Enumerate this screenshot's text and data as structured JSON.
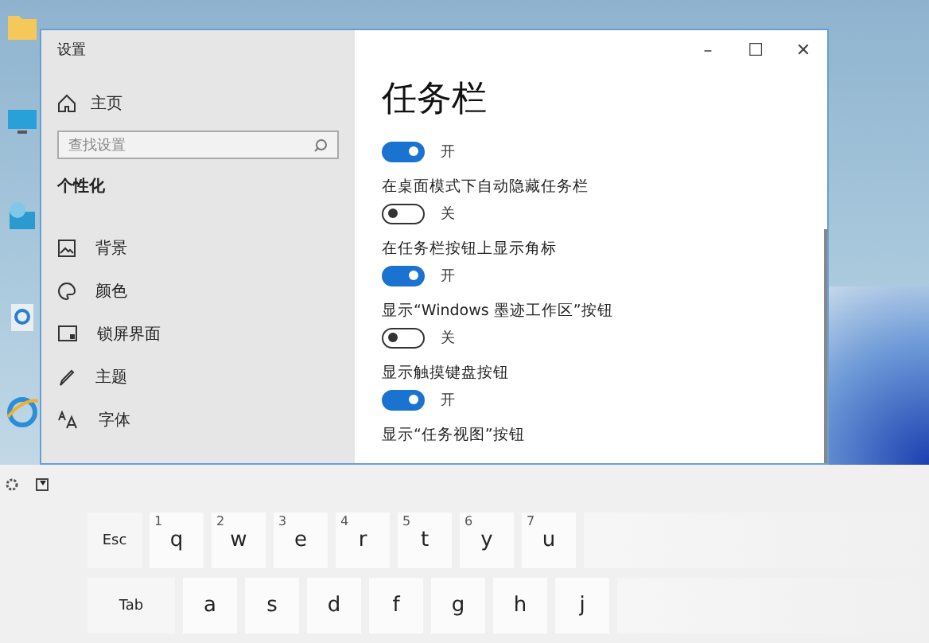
{
  "window": {
    "title": "设置",
    "controls": [
      "–",
      "☐",
      "✕"
    ]
  },
  "sidebar": {
    "home": "主页",
    "search": {
      "placeholder": "查找设置"
    },
    "section": "个性化",
    "items": [
      {
        "label": "背景"
      },
      {
        "label": "颜色"
      },
      {
        "label": "锁屏界面"
      },
      {
        "label": "主题"
      },
      {
        "label": "字体"
      }
    ]
  },
  "page": {
    "title": "任务栏",
    "settings": [
      {
        "on": true,
        "state": "开"
      },
      {
        "label": "在桌面模式下自动隐藏任务栏",
        "on": false,
        "state": "关"
      },
      {
        "label": "在任务栏按钮上显示角标",
        "on": true,
        "state": "开"
      },
      {
        "label": "显示“Windows 墨迹工作区”按钮",
        "on": false,
        "state": "关"
      },
      {
        "label": "显示触摸键盘按钮",
        "on": true,
        "state": "开"
      },
      {
        "label": "显示“任务视图”按钮"
      }
    ]
  },
  "keyboard": {
    "rows": [
      [
        {
          "key": "Esc",
          "kind": "wide"
        },
        {
          "key": "q",
          "hint": "1"
        },
        {
          "key": "w",
          "hint": "2"
        },
        {
          "key": "e",
          "hint": "3"
        },
        {
          "key": "r",
          "hint": "4"
        },
        {
          "key": "t",
          "hint": "5"
        },
        {
          "key": "y",
          "hint": "6"
        },
        {
          "key": "u",
          "hint": "7"
        }
      ],
      [
        {
          "key": "Tab",
          "kind": "tab"
        },
        {
          "key": "a"
        },
        {
          "key": "s"
        },
        {
          "key": "d"
        },
        {
          "key": "f"
        },
        {
          "key": "g"
        },
        {
          "key": "h"
        },
        {
          "key": "j"
        }
      ]
    ]
  }
}
